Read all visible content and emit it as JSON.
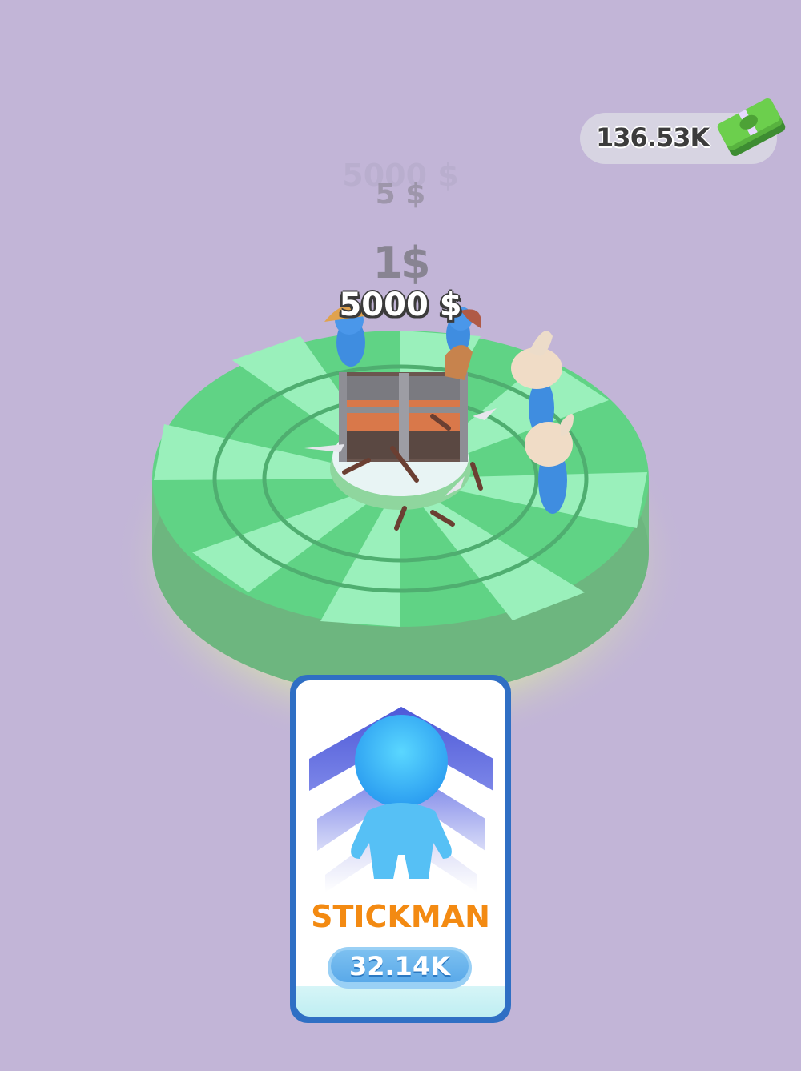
{
  "hud": {
    "money": "136.53K",
    "money_icon": "cash-stack-icon"
  },
  "floating_texts": {
    "faded_top": "5000 $",
    "five": "5 $",
    "one": "1$",
    "main": "5000 $"
  },
  "upgrade_card": {
    "title": "STICKMAN",
    "price": "32.14K",
    "icon": "stickman-upgrade-icon"
  },
  "colors": {
    "background": "#c2b5d7",
    "ring_light": "#97ecbb",
    "ring_dark": "#5fd283",
    "card_border": "#2f6fc4",
    "title_orange": "#f38a12",
    "stickman_blue": "#47b8f2"
  }
}
